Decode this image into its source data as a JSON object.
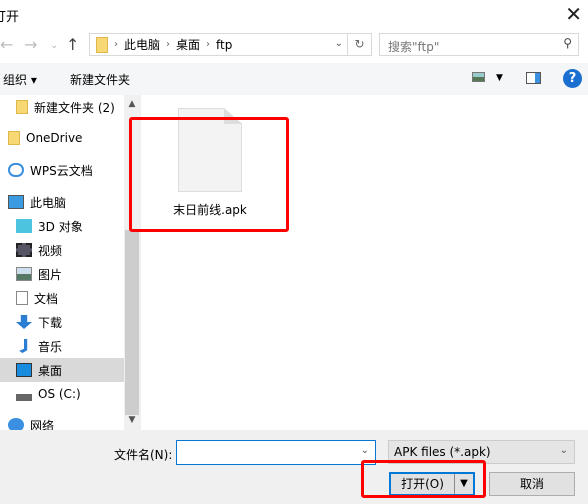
{
  "window": {
    "title": "打开",
    "close_icon": "close-icon"
  },
  "address": {
    "crumbs": [
      "此电脑",
      "桌面",
      "ftp"
    ]
  },
  "search": {
    "placeholder": "搜索\"ftp\""
  },
  "toolbar": {
    "organize": "组织 ▾",
    "new_folder": "新建文件夹",
    "help": "?"
  },
  "sidebar": {
    "items": [
      {
        "label": "新建文件夹 (2)",
        "icon": "folder-icon"
      },
      {
        "label": "OneDrive",
        "icon": "folder-icon"
      },
      {
        "label": "WPS云文档",
        "icon": "cloud-icon"
      },
      {
        "label": "此电脑",
        "icon": "computer-icon"
      },
      {
        "label": "3D 对象",
        "icon": "cube-icon"
      },
      {
        "label": "视频",
        "icon": "video-icon"
      },
      {
        "label": "图片",
        "icon": "picture-icon"
      },
      {
        "label": "文档",
        "icon": "document-icon"
      },
      {
        "label": "下载",
        "icon": "download-icon"
      },
      {
        "label": "音乐",
        "icon": "music-icon"
      },
      {
        "label": "桌面",
        "icon": "desktop-icon",
        "selected": true
      },
      {
        "label": "OS (C:)",
        "icon": "drive-icon"
      },
      {
        "label": "网络",
        "icon": "network-icon"
      }
    ]
  },
  "files": [
    {
      "name": "末日前线.apk",
      "icon": "file-icon"
    }
  ],
  "bottom": {
    "filename_label": "文件名(N):",
    "filename_value": "",
    "filetype": "APK files (*.apk)",
    "open": "打开(O)",
    "cancel": "取消"
  },
  "colors": {
    "highlight": "#ff0000",
    "accent": "#0078d7"
  }
}
